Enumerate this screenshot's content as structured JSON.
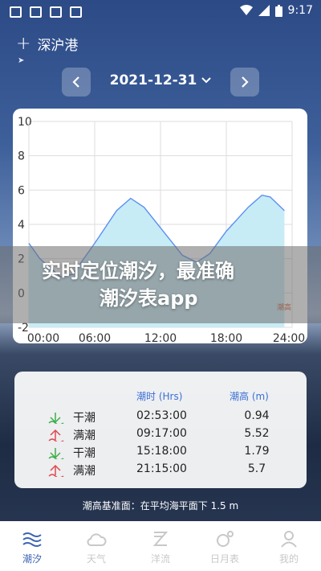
{
  "status_bar": {
    "time": "9:17"
  },
  "header": {
    "location": "深沪港"
  },
  "date_nav": {
    "date": "2021-12-31"
  },
  "chart_data": {
    "type": "area",
    "x_ticks": [
      "00:00",
      "06:00",
      "12:00",
      "18:00",
      "24:00"
    ],
    "y_ticks": [
      "10",
      "8",
      "6",
      "4",
      "2",
      "0",
      "-2"
    ],
    "ylim": [
      -2,
      10
    ],
    "xlim": [
      0,
      24
    ],
    "series": [
      {
        "name": "潮高",
        "x": [
          0,
          1,
          2.88,
          4,
          6,
          8,
          9.28,
          10.5,
          12,
          14,
          15.3,
          16.5,
          18,
          20,
          21.25,
          22,
          23.3
        ],
        "values": [
          2.9,
          2.0,
          0.94,
          1.1,
          2.9,
          4.8,
          5.52,
          5.0,
          3.8,
          2.2,
          1.79,
          2.3,
          3.6,
          5.0,
          5.7,
          5.6,
          4.8
        ]
      }
    ],
    "legend": "潮高",
    "corner_label": "潮高",
    "color": "#5b8ff0",
    "fill": "#c8ecf6",
    "grid": true
  },
  "banner": {
    "line1": "实时定位潮汐，最准确",
    "line2": "潮汐表app"
  },
  "tide_table": {
    "headers": {
      "time": "潮时 (Hrs)",
      "height": "潮高 (m)"
    },
    "rows": [
      {
        "type": "干潮",
        "time": "02:53:00",
        "height": "0.94",
        "kind": "low"
      },
      {
        "type": "满潮",
        "time": "09:17:00",
        "height": "5.52",
        "kind": "high"
      },
      {
        "type": "干潮",
        "time": "15:18:00",
        "height": "1.79",
        "kind": "low"
      },
      {
        "type": "满潮",
        "time": "21:15:00",
        "height": "5.7",
        "kind": "high"
      }
    ]
  },
  "datum_note": "潮高基准面：在平均海平面下 1.5 m",
  "bottom_nav": [
    {
      "label": "潮汐",
      "icon": "waves-icon",
      "active": true
    },
    {
      "label": "天气",
      "icon": "cloud-icon",
      "active": false
    },
    {
      "label": "洋流",
      "icon": "current-icon",
      "active": false
    },
    {
      "label": "日月表",
      "icon": "sun-moon-icon",
      "active": false
    },
    {
      "label": "我的",
      "icon": "profile-icon",
      "active": false
    }
  ],
  "colors": {
    "low": "#3fae49",
    "high": "#e0484e",
    "accent": "#3d64b4"
  }
}
